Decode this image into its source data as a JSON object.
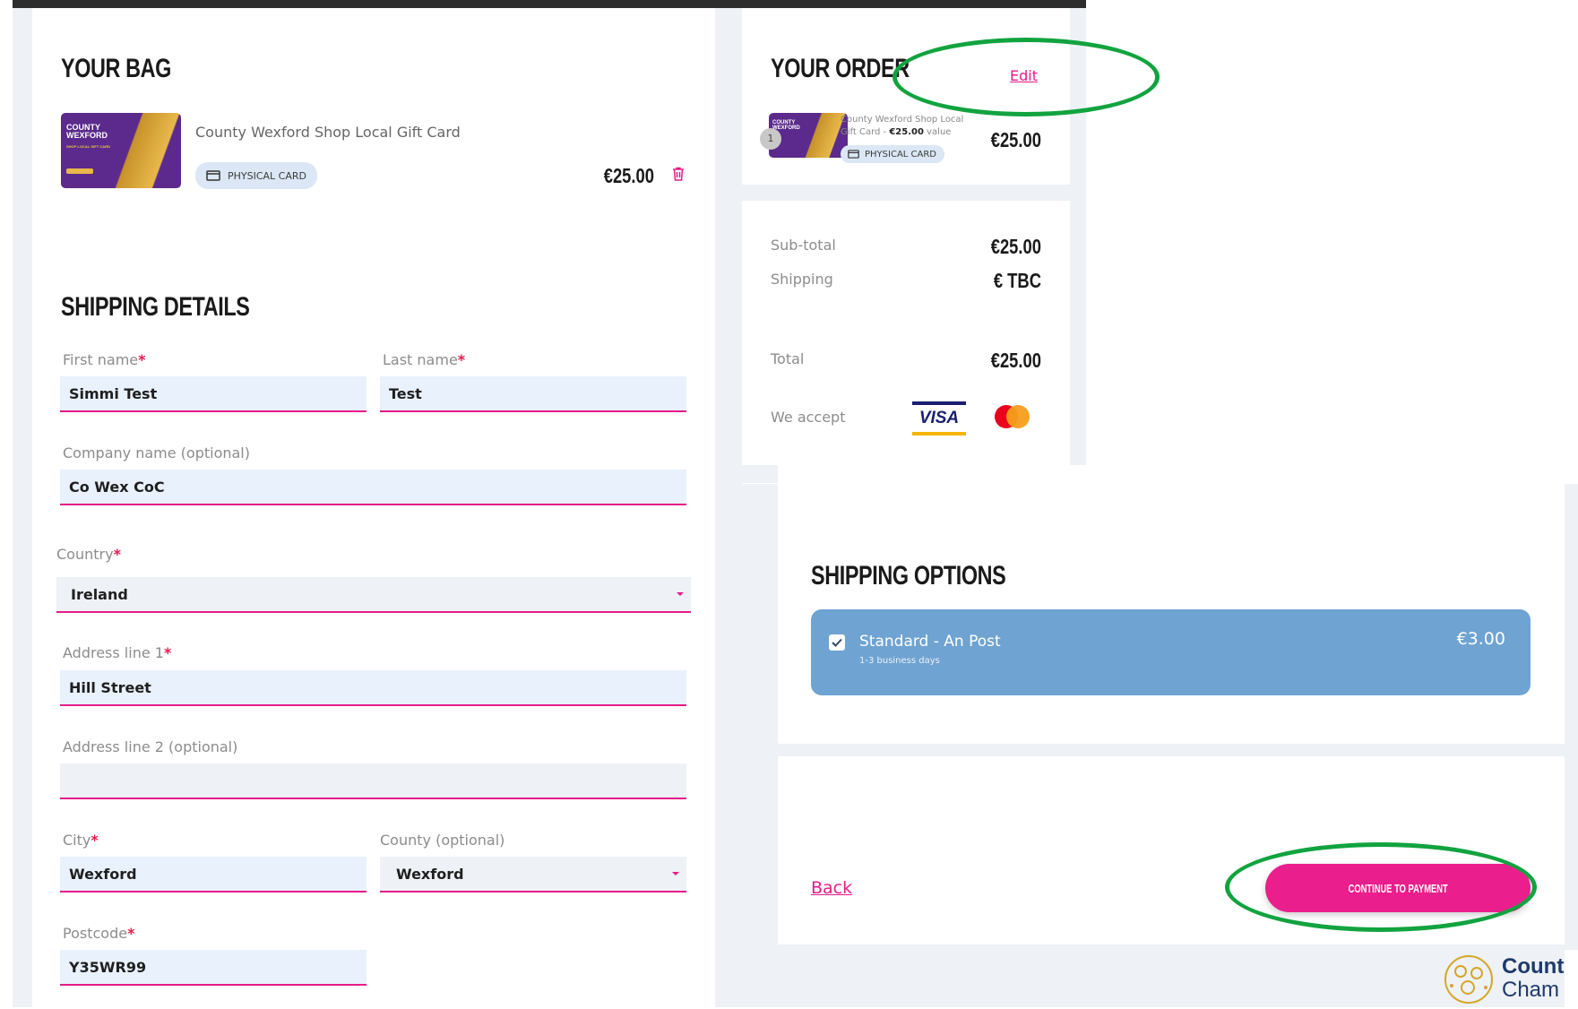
{
  "bag": {
    "title": "YOUR BAG",
    "item_name": "County Wexford Shop Local Gift Card",
    "item_type": "PHYSICAL CARD",
    "item_price": "€25.00",
    "card_text_line1": "COUNTY",
    "card_text_line2": "WEXFORD",
    "card_text_line3": "SHOP LOCAL GIFT CARD"
  },
  "shipping_details": {
    "title": "SHIPPING DETAILS",
    "first_name_label": "First name",
    "first_name_value": "Simmi Test",
    "last_name_label": "Last name",
    "last_name_value": "Test",
    "company_label": "Company name (optional)",
    "company_value": "Co Wex CoC",
    "country_label": "Country",
    "country_value": "Ireland",
    "address1_label": "Address line 1",
    "address1_value": "Hill Street",
    "address2_label": "Address line 2 (optional)",
    "address2_value": "",
    "city_label": "City",
    "city_value": "Wexford",
    "county_label": "County (optional)",
    "county_value": "Wexford",
    "postcode_label": "Postcode",
    "postcode_value": "Y35WR99",
    "required_mark": "*"
  },
  "order": {
    "title": "YOUR ORDER",
    "edit_label": "Edit",
    "item_qty": "1",
    "item_desc_line1": "County Wexford Shop Local",
    "item_desc_line2_prefix": "Gift Card - ",
    "item_desc_value": "€25.00",
    "item_desc_suffix": " value",
    "item_type": "PHYSICAL CARD",
    "item_price": "€25.00",
    "subtotal_label": "Sub-total",
    "subtotal_value": "€25.00",
    "shipping_label": "Shipping",
    "shipping_value": "€ TBC",
    "total_label": "Total",
    "total_value": "€25.00",
    "accept_label": "We accept",
    "visa_label": "VISA"
  },
  "shipping_options": {
    "title": "SHIPPING OPTIONS",
    "option_name": "Standard - An Post",
    "option_sub": "1-3 business days",
    "option_price": "€3.00",
    "option_checked": true
  },
  "actions": {
    "back_label": "Back",
    "continue_label": "CONTINUE TO PAYMENT"
  },
  "logo": {
    "line1": "Count",
    "line2": "Cham"
  },
  "colors": {
    "accent": "#e61b8a",
    "field_bg": "#e9f1fd",
    "option_bg": "#6fa3d2",
    "highlight_oval": "#11a33f"
  },
  "icons": [
    "trash-icon",
    "card-icon",
    "checkbox-icon",
    "visa-logo",
    "mastercard-logo",
    "chamber-logo"
  ]
}
